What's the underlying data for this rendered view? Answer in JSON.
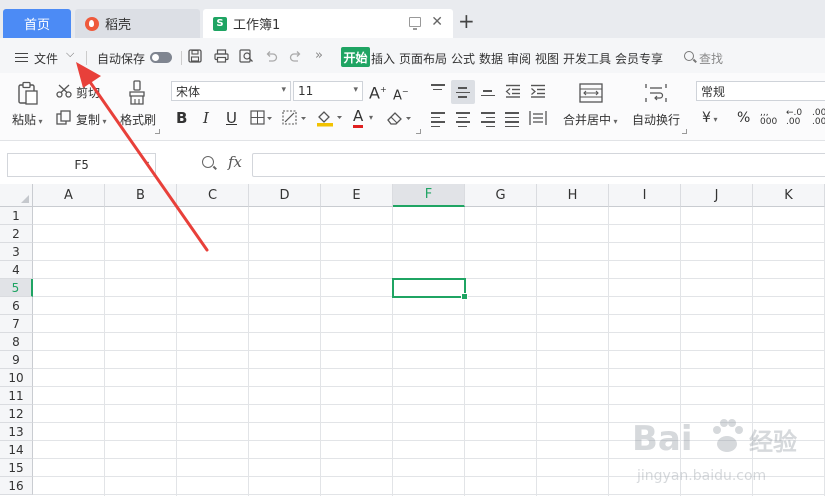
{
  "tabs": {
    "home": "首页",
    "daoke": "稻壳",
    "workbook": "工作簿1",
    "workbook_icon": "S"
  },
  "menu": {
    "file": "文件",
    "autosave": "自动保存",
    "tabs": [
      "开始",
      "插入",
      "页面布局",
      "公式",
      "数据",
      "审阅",
      "视图",
      "开发工具",
      "会员专享"
    ],
    "search": "查找"
  },
  "ribbon": {
    "paste": "粘贴",
    "cut": "剪切",
    "copy": "复制",
    "format_painter": "格式刷",
    "font_name": "宋体",
    "font_size": "11",
    "merge_center": "合并居中",
    "wrap_text": "自动换行",
    "number_format": "常规",
    "currency_symbol": "¥",
    "percent_symbol": "%",
    "thousands_symbol": "000",
    "inc_decimal": ".00",
    "dec_decimal": ".00",
    "bold": "B",
    "italic": "I",
    "underline": "U",
    "font_color_letter": "A",
    "grow_font": "A",
    "shrink_font": "A",
    "colors": {
      "font_color_bar": "#e02020",
      "fill_color_bar": "#f2c200"
    }
  },
  "formula_bar": {
    "name_box": "F5",
    "fx_label": "fx",
    "formula": ""
  },
  "sheet": {
    "columns": [
      "A",
      "B",
      "C",
      "D",
      "E",
      "F",
      "G",
      "H",
      "I",
      "J",
      "K"
    ],
    "rows": [
      "1",
      "2",
      "3",
      "4",
      "5",
      "6",
      "7",
      "8",
      "9",
      "10",
      "11",
      "12",
      "13",
      "14",
      "15",
      "16"
    ],
    "active_column": "F",
    "active_row": "5",
    "accent": "#1fa463"
  },
  "watermark": {
    "brand": "Bai",
    "brand_suffix": "经验",
    "url": "jingyan.baidu.com"
  },
  "annotation": {
    "arrow_color": "#e8403a"
  }
}
